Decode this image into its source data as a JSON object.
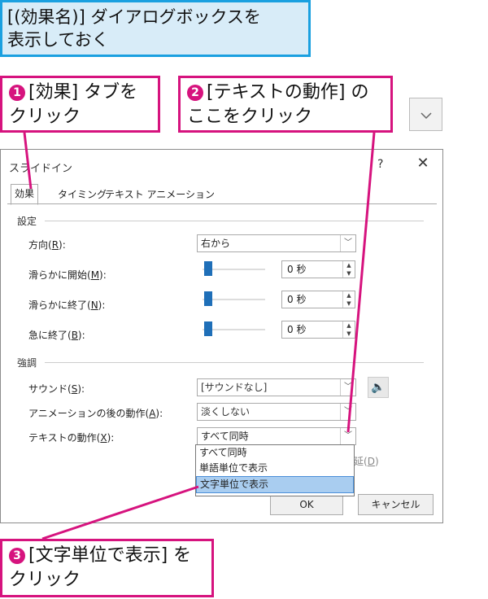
{
  "instruction": "[(効果名)] ダイアログボックスを表示しておく",
  "instruction_line1": "[(効果名)] ダイアログボックスを",
  "instruction_line2": "表示しておく",
  "callouts": {
    "c1": {
      "num": "1",
      "line1": "[効果] タブを",
      "line2": "クリック"
    },
    "c2": {
      "num": "2",
      "line1": "[テキストの動作] の",
      "line2": "ここをクリック"
    },
    "c3": {
      "num": "3",
      "line1": "[文字単位で表示] を",
      "line2": "クリック"
    }
  },
  "expand_icon": "chevron-down-icon",
  "dialog": {
    "title": "スライドイン",
    "help": "?",
    "close": "✕",
    "tabs": [
      "効果",
      "タイミング",
      "テキスト アニメーション"
    ],
    "settings": {
      "section": "設定",
      "direction_label": "方向(",
      "direction_key": "R",
      "direction_tail": "):",
      "direction_value": "右から",
      "smooth_start_label": "滑らかに開始(",
      "smooth_start_key": "M",
      "smooth_start_tail": "):",
      "smooth_start_value": "0 秒",
      "smooth_end_label": "滑らかに終了(",
      "smooth_end_key": "N",
      "smooth_end_tail": "):",
      "smooth_end_value": "0 秒",
      "bounce_end_label": "急に終了(",
      "bounce_end_key": "B",
      "bounce_end_tail": "):",
      "bounce_end_value": "0 秒"
    },
    "enhancements": {
      "section": "強調",
      "sound_label": "サウンド(",
      "sound_key": "S",
      "sound_tail": "):",
      "sound_value": "[サウンドなし]",
      "after_label": "アニメーションの後の動作(",
      "after_key": "A",
      "after_tail": "):",
      "after_value": "淡くしない",
      "text_anim_label": "テキストの動作(",
      "text_anim_key": "X",
      "text_anim_tail": "):",
      "text_anim_value": "すべて同時",
      "delay_partial_label": "延(",
      "delay_partial_key": "D",
      "delay_partial_tail": ")"
    },
    "dropdown_options": [
      "すべて同時",
      "単語単位で表示",
      "文字単位で表示"
    ],
    "ok": "OK",
    "cancel": "キャンセル"
  },
  "colors": {
    "accent": "#d6137e",
    "title_border": "#1aa0e0",
    "title_bg": "#d8ecf8",
    "slider": "#1f6fb8",
    "highlight": "#a9cdf0"
  }
}
